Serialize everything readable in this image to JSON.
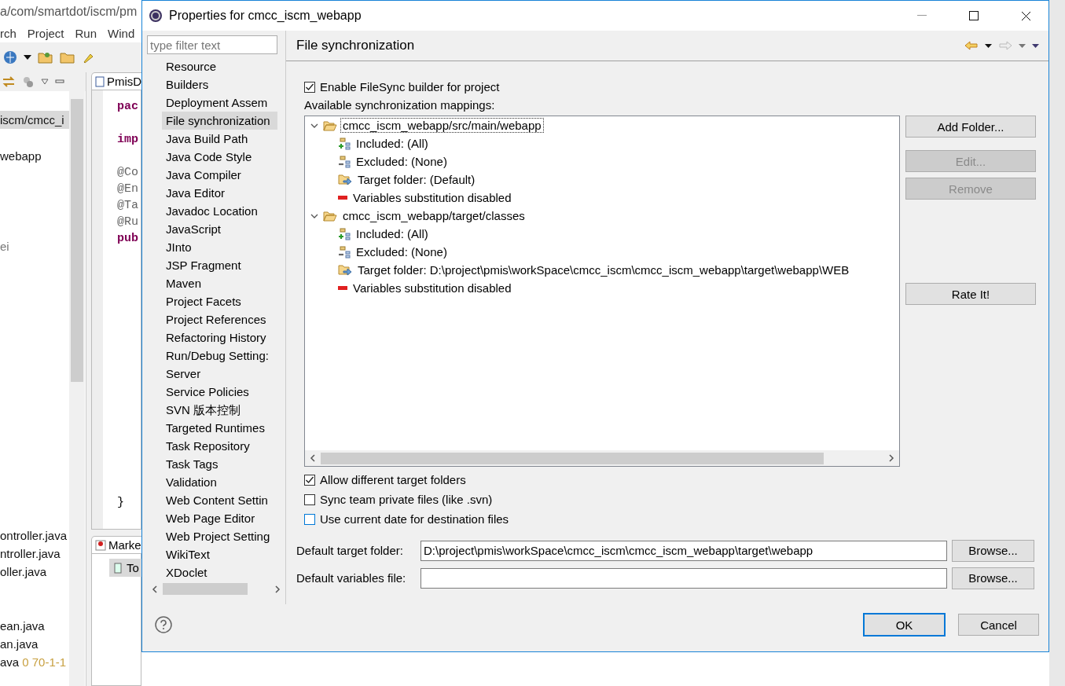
{
  "background": {
    "title": "a/com/smartdot/iscm/pm",
    "menu": [
      "rch",
      "Project",
      "Run",
      "Wind"
    ],
    "explorer": {
      "items": [
        {
          "label": "iscm/cmcc_i",
          "selected": true
        },
        {
          "label": "webapp",
          "selected": false
        },
        {
          "label": "ei",
          "selected": false
        },
        {
          "label": "ontroller.java",
          "selected": false
        },
        {
          "label": "ntroller.java",
          "selected": false
        },
        {
          "label": "oller.java",
          "selected": false
        },
        {
          "label": "ean.java",
          "selected": false
        },
        {
          "label": "an.java",
          "selected": false
        },
        {
          "label": "ava",
          "decoration": "0  70-1-1",
          "selected": false
        }
      ]
    },
    "editor": {
      "tab": "PmisD",
      "lines": [
        {
          "text": "pac",
          "kind": "keyword"
        },
        {
          "text": "imp",
          "kind": "keyword"
        },
        {
          "text": "@Co",
          "kind": "annotation"
        },
        {
          "text": "@En",
          "kind": "annotation"
        },
        {
          "text": "@Ta",
          "kind": "annotation"
        },
        {
          "text": "@Ru",
          "kind": "annotation"
        },
        {
          "text": "pub",
          "kind": "keyword"
        },
        {
          "text": "}",
          "kind": "plain"
        }
      ]
    },
    "bottom_panel": {
      "tab": "Marke",
      "item": "To"
    }
  },
  "dialog": {
    "title": "Properties for cmcc_iscm_webapp",
    "filter": {
      "placeholder": "type filter text"
    },
    "nav": [
      {
        "label": "Resource",
        "selected": false
      },
      {
        "label": "Builders",
        "selected": false
      },
      {
        "label": "Deployment Assem",
        "selected": false
      },
      {
        "label": "File synchronization",
        "selected": true
      },
      {
        "label": "Java Build Path",
        "selected": false
      },
      {
        "label": "Java Code Style",
        "selected": false
      },
      {
        "label": "Java Compiler",
        "selected": false
      },
      {
        "label": "Java Editor",
        "selected": false
      },
      {
        "label": "Javadoc Location",
        "selected": false
      },
      {
        "label": "JavaScript",
        "selected": false
      },
      {
        "label": "JInto",
        "selected": false
      },
      {
        "label": "JSP Fragment",
        "selected": false
      },
      {
        "label": "Maven",
        "selected": false
      },
      {
        "label": "Project Facets",
        "selected": false
      },
      {
        "label": "Project References",
        "selected": false
      },
      {
        "label": "Refactoring History",
        "selected": false
      },
      {
        "label": "Run/Debug Setting:",
        "selected": false
      },
      {
        "label": "Server",
        "selected": false
      },
      {
        "label": "Service Policies",
        "selected": false
      },
      {
        "label": "SVN 版本控制",
        "selected": false
      },
      {
        "label": "Targeted Runtimes",
        "selected": false
      },
      {
        "label": "Task Repository",
        "selected": false
      },
      {
        "label": "Task Tags",
        "selected": false
      },
      {
        "label": "Validation",
        "selected": false
      },
      {
        "label": "Web Content Settin",
        "selected": false
      },
      {
        "label": "Web Page Editor",
        "selected": false
      },
      {
        "label": "Web Project Setting",
        "selected": false
      },
      {
        "label": "WikiText",
        "selected": false
      },
      {
        "label": "XDoclet",
        "selected": false
      }
    ],
    "page_title": "File synchronization",
    "enable": {
      "label": "Enable FileSync builder for project",
      "checked": true
    },
    "mappings_label": "Available synchronization mappings:",
    "mappings": [
      {
        "label": "cmcc_iscm_webapp/src/main/webapp",
        "expanded": true,
        "selected": true,
        "children": [
          {
            "kind": "included",
            "label": "Included: (All)"
          },
          {
            "kind": "excluded",
            "label": "Excluded: (None)"
          },
          {
            "kind": "target",
            "label": "Target folder: (Default)"
          },
          {
            "kind": "variables",
            "label": "Variables substitution disabled"
          }
        ]
      },
      {
        "label": "cmcc_iscm_webapp/target/classes",
        "expanded": true,
        "selected": false,
        "children": [
          {
            "kind": "included",
            "label": "Included: (All)"
          },
          {
            "kind": "excluded",
            "label": "Excluded: (None)"
          },
          {
            "kind": "target",
            "label": "Target folder: D:\\project\\pmis\\workSpace\\cmcc_iscm\\cmcc_iscm_webapp\\target\\webapp\\WEB"
          },
          {
            "kind": "variables",
            "label": "Variables substitution disabled"
          }
        ]
      }
    ],
    "side_buttons": [
      {
        "label": "Add Folder...",
        "disabled": false
      },
      {
        "label": "Edit...",
        "disabled": true
      },
      {
        "label": "Remove",
        "disabled": true
      }
    ],
    "rate_button": "Rate It!",
    "options": [
      {
        "label": "Allow different target folders",
        "checked": true,
        "hovered": false
      },
      {
        "label": "Sync team private files (like .svn)",
        "checked": false,
        "hovered": false
      },
      {
        "label": "Use current date for destination files",
        "checked": false,
        "hovered": true
      }
    ],
    "fields": [
      {
        "label": "Default target folder:",
        "value": "D:\\project\\pmis\\workSpace\\cmcc_iscm\\cmcc_iscm_webapp\\target\\webapp",
        "button": "Browse..."
      },
      {
        "label": "Default variables file:",
        "button": "Browse..."
      }
    ],
    "footer_buttons": [
      {
        "label": "OK",
        "default": true
      },
      {
        "label": "Cancel",
        "default": false
      }
    ]
  }
}
